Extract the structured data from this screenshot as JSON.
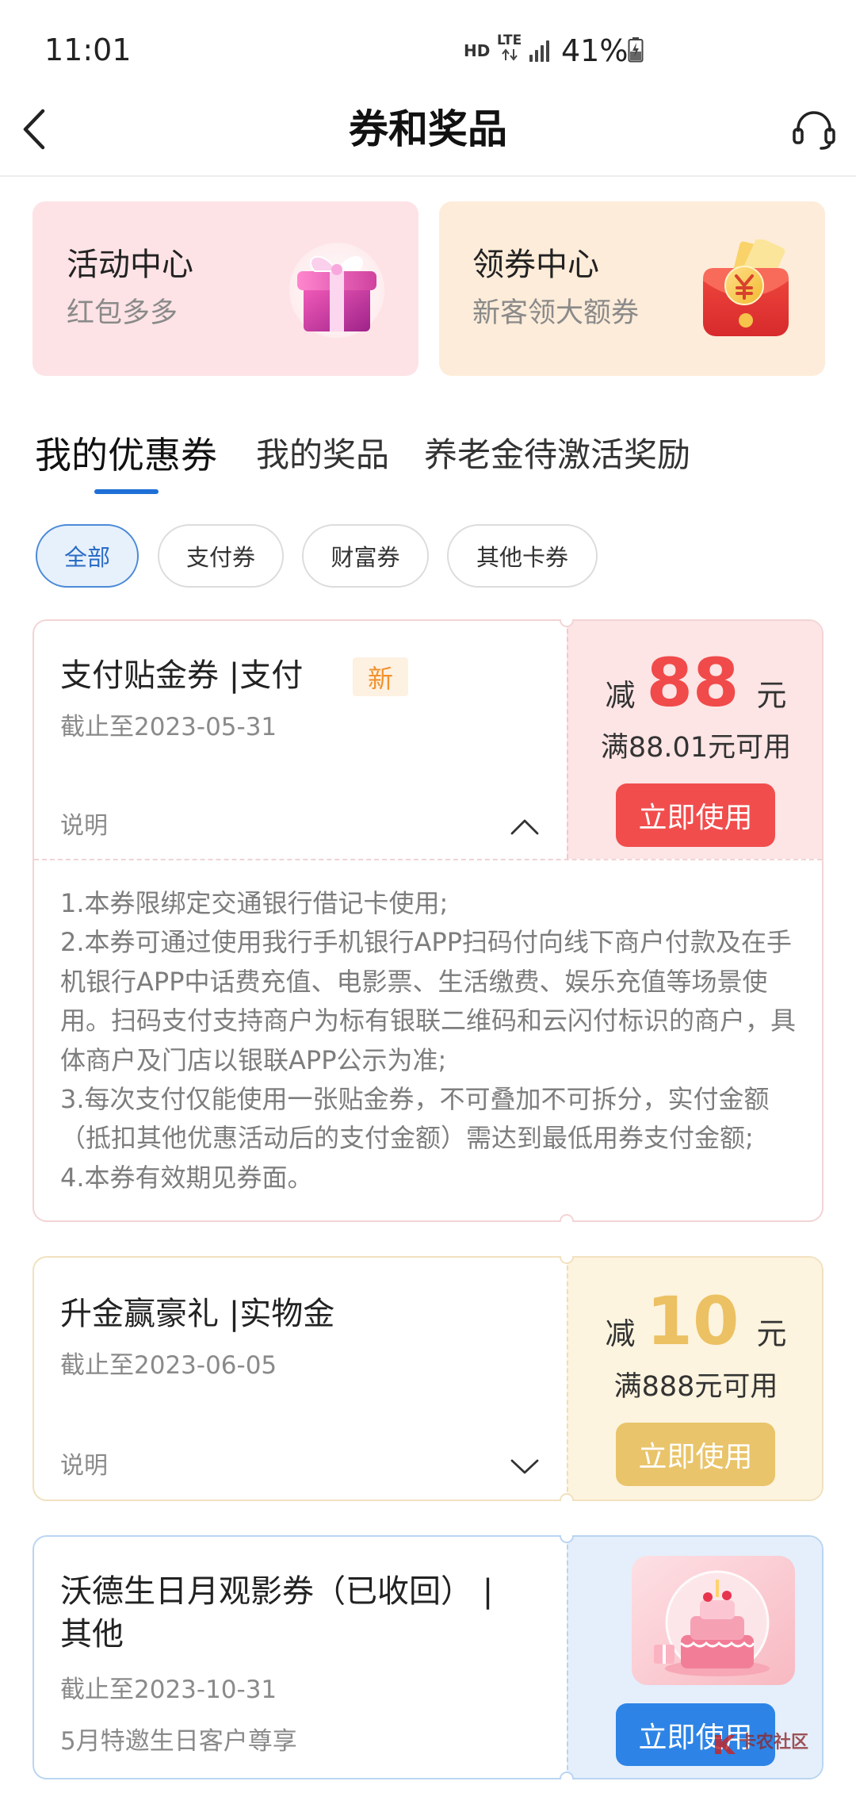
{
  "status_bar": {
    "time": "11:01",
    "hd": "HD",
    "network": "LTE",
    "battery": "41%"
  },
  "header": {
    "title": "券和奖品",
    "back_icon": "back-arrow-icon",
    "service_icon": "headset-icon"
  },
  "promo_cards": [
    {
      "title": "活动中心",
      "subtitle": "红包多多",
      "icon": "gift-box-icon",
      "background": "#fde3e6"
    },
    {
      "title": "领券中心",
      "subtitle": "新客领大额券",
      "icon": "red-envelope-icon",
      "background": "#fdecd9"
    }
  ],
  "tabs": [
    {
      "label": "我的优惠券",
      "active": true
    },
    {
      "label": "我的奖品",
      "active": false
    },
    {
      "label": "养老金待激活奖励",
      "active": false
    }
  ],
  "filters": [
    {
      "label": "全部",
      "selected": true
    },
    {
      "label": "支付券",
      "selected": false
    },
    {
      "label": "财富券",
      "selected": false
    },
    {
      "label": "其他卡券",
      "selected": false
    }
  ],
  "coupons": [
    {
      "title": "支付贴金券 |支付",
      "badge": "新",
      "expiry": "截止至2023-05-31",
      "note_label": "说明",
      "note_toggle_icon": "chevron-up-icon",
      "note_expanded": true,
      "amount_prefix": "减",
      "amount": "88",
      "amount_unit": "元",
      "condition": "满88.01元可用",
      "button": "立即使用",
      "description": [
        "1.本券限绑定交通银行借记卡使用;",
        "2.本券可通过使用我行手机银行APP扫码付向线下商户付款及在手",
        "机银行APP中话费充值、电影票、生活缴费、娱乐充值等场景使",
        "用。扫码支付支持商户为标有银联二维码和云闪付标识的商户，具",
        "体商户及门店以银联APP公示为准;",
        "3.每次支付仅能使用一张贴金券，不可叠加不可拆分，实付金额",
        "（抵扣其他优惠活动后的支付金额）需达到最低用券支付金额;",
        "4.本券有效期见券面。"
      ],
      "colors": {
        "amount": "#f04a4a",
        "button": "#f14d4d",
        "panel": "#fde4e5",
        "border": "#f3d4d6"
      }
    },
    {
      "title": "升金赢豪礼 |实物金",
      "expiry": "截止至2023-06-05",
      "note_label": "说明",
      "note_toggle_icon": "chevron-down-icon",
      "note_expanded": false,
      "amount_prefix": "减",
      "amount": "10",
      "amount_unit": "元",
      "condition": "满888元可用",
      "button": "立即使用",
      "colors": {
        "amount": "#ecc163",
        "button": "#e9c46a",
        "panel": "#fdf4df",
        "border": "#f1e1bf"
      }
    },
    {
      "title_lines": [
        "沃德生日月观影券（已收回） |",
        "其他"
      ],
      "expiry": "截止至2023-10-31",
      "subtitle": "5月特邀生日客户尊享",
      "image": "birthday-cake-image",
      "button": "立即使用",
      "colors": {
        "button": "#2d84e6",
        "panel": "#e4effb",
        "border": "#bad5f2"
      }
    }
  ],
  "watermark": {
    "text": "卡农社区"
  },
  "theme": {
    "accent": "#1e6fd6"
  }
}
